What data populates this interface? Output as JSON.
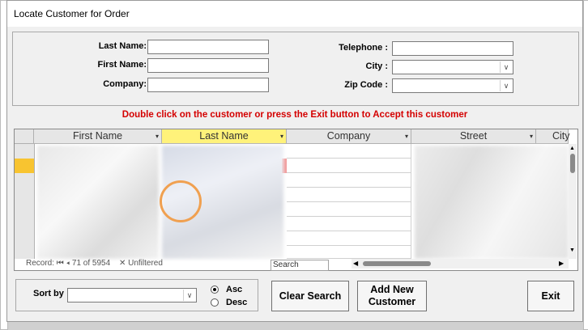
{
  "dialog": {
    "title": "Locate Customer for Order"
  },
  "search_form": {
    "last_name_label": "Last Name:",
    "first_name_label": "First Name:",
    "company_label": "Company:",
    "telephone_label": "Telephone :",
    "city_label": "City :",
    "zip_label": "Zip Code :",
    "last_name_value": "",
    "first_name_value": "",
    "company_value": "",
    "telephone_value": "",
    "city_value": "",
    "zip_value": ""
  },
  "instruction": "Double click on the customer or press the Exit button to Accept this customer",
  "grid": {
    "columns": [
      {
        "label": "First Name"
      },
      {
        "label": "Last Name"
      },
      {
        "label": "Company"
      },
      {
        "label": "Street"
      },
      {
        "label": "City"
      }
    ],
    "record_label": "Record:",
    "record_value": "71 of 5954",
    "filter_label": "Unfiltered",
    "search_placeholder": "Search"
  },
  "footer": {
    "sort_label": "Sort by",
    "sort_value": "",
    "asc_label": "Asc",
    "desc_label": "Desc",
    "clear_search": "Clear Search",
    "add_new_line1": "Add New",
    "add_new_line2": "Customer",
    "exit": "Exit"
  },
  "icons": {
    "dropdown": "chevron-down-icon",
    "nav_first": "first-record-icon",
    "nav_prev": "prev-record-icon",
    "filter": "filter-icon"
  },
  "colors": {
    "instruction": "#d40000",
    "selected_header": "#fff27a"
  }
}
